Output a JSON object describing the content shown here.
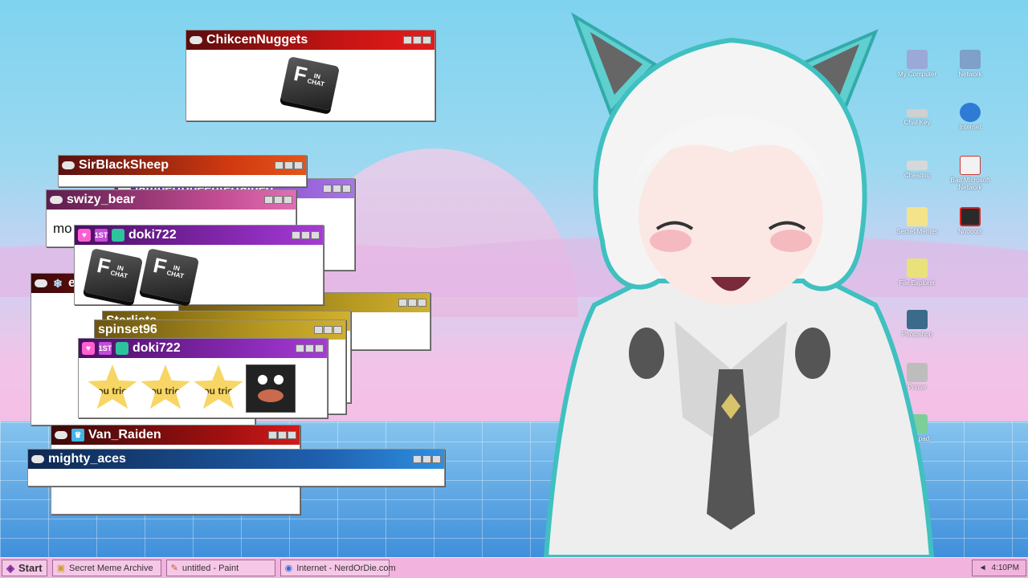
{
  "chat_windows": [
    {
      "id": "w-chikcen",
      "user": "ChikcenNuggets",
      "content": "f-in-chat"
    },
    {
      "id": "w-sirblack",
      "user": "SirBlackSheep"
    },
    {
      "id": "w-jambers",
      "user": "jambertobeentertained"
    },
    {
      "id": "w-swizy",
      "user": "swizy_bear",
      "message": "mo"
    },
    {
      "id": "w-doki1",
      "user": "doki722",
      "badge_rank": "1ST",
      "content": "two f-in-chat"
    },
    {
      "id": "w-snow",
      "user": "e"
    },
    {
      "id": "w-gold",
      "user": ""
    },
    {
      "id": "w-starlists",
      "user": "Starlists"
    },
    {
      "id": "w-spinset",
      "user": "spinset96"
    },
    {
      "id": "w-doki2",
      "user": "doki722",
      "badge_rank": "1ST",
      "stars": [
        "you tried",
        "you tried",
        "you tried"
      ]
    },
    {
      "id": "w-vanraiden",
      "user": "Van_Raiden"
    },
    {
      "id": "w-mighty",
      "user": "mighty_aces"
    }
  ],
  "emote": {
    "f": "F",
    "in": "IN",
    "chat": "CHAT"
  },
  "desktop_icons": [
    "My Computer",
    "Network",
    "Chat Key",
    "Internet",
    "Cheating",
    "Bad Microsoft Network",
    "Secret Memes",
    "Nodoots",
    "File Explorer",
    "Photoshop",
    "Printer",
    "Notepad"
  ],
  "taskbar": {
    "start": "Start",
    "items": [
      "Secret Meme Archive",
      "untitled - Paint",
      "Internet - NerdOrDie.com"
    ],
    "clock": "4:10PM"
  }
}
